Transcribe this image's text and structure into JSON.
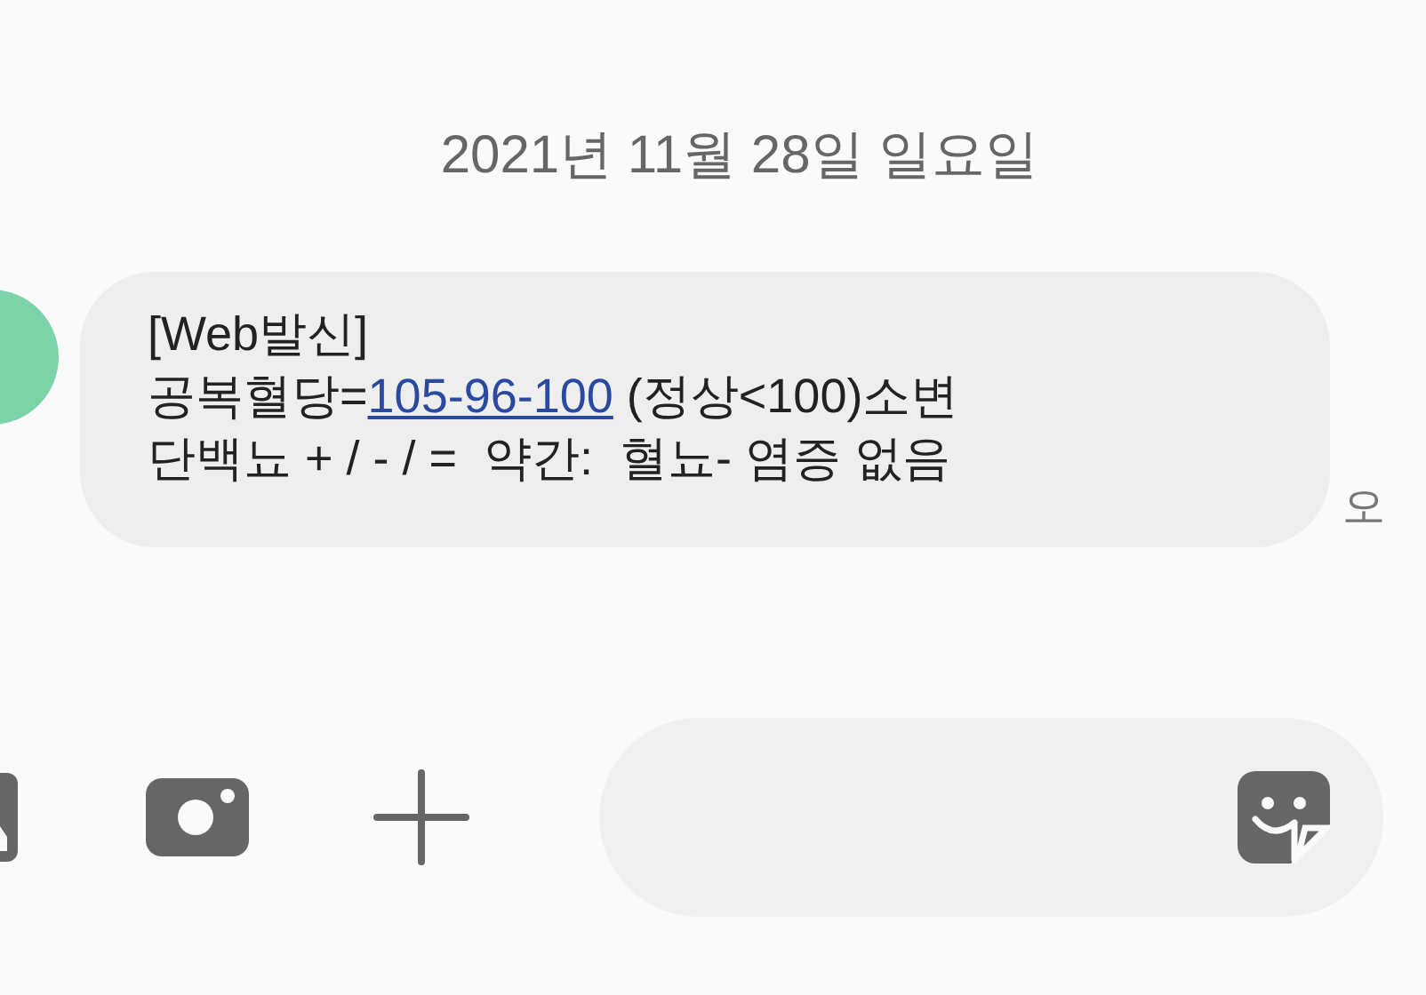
{
  "date_header": "2021년 11월 28일 일요일",
  "message": {
    "parts": [
      {
        "kind": "text",
        "text": "[Web발신]\n공복혈당="
      },
      {
        "kind": "link",
        "text": "105-96-100"
      },
      {
        "kind": "text",
        "text": " (정상<100)소변\n단백뇨 + / - / =  약간:  혈뇨- 염증 없음"
      }
    ],
    "time": "오"
  }
}
